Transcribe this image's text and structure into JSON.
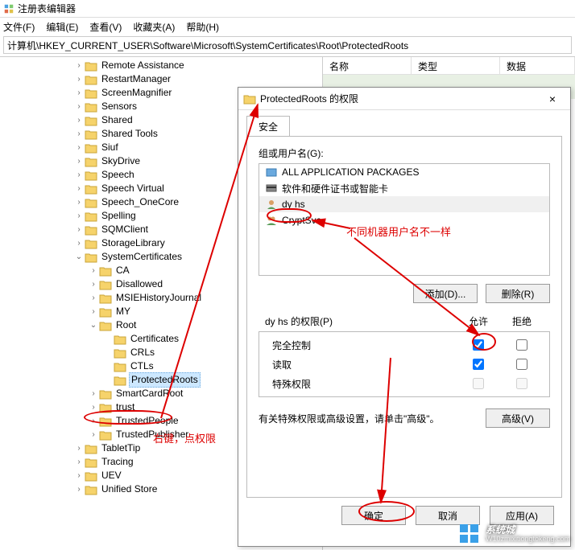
{
  "window": {
    "title": "注册表编辑器"
  },
  "menu": {
    "file": "文件(F)",
    "edit": "编辑(E)",
    "view": "查看(V)",
    "favorites": "收藏夹(A)",
    "help": "帮助(H)"
  },
  "address": {
    "path": "计算机\\HKEY_CURRENT_USER\\Software\\Microsoft\\SystemCertificates\\Root\\ProtectedRoots"
  },
  "listcols": {
    "name": "名称",
    "type": "类型",
    "data": "数据"
  },
  "tree": {
    "items": [
      "Remote Assistance",
      "RestartManager",
      "ScreenMagnifier",
      "Sensors",
      "Shared",
      "Shared Tools",
      "Siuf",
      "SkyDrive",
      "Speech",
      "Speech Virtual",
      "Speech_OneCore",
      "Spelling",
      "SQMClient",
      "StorageLibrary"
    ],
    "syscert": "SystemCertificates",
    "syscert_children": [
      "CA",
      "Disallowed",
      "MSIEHistoryJournal",
      "MY"
    ],
    "root": "Root",
    "root_children": [
      "Certificates",
      "CRLs",
      "CTLs",
      "ProtectedRoots"
    ],
    "after_root": [
      "SmartCardRoot",
      "trust",
      "TrustedPeople",
      "TrustedPublisher"
    ],
    "after_syscert": [
      "TabletTip",
      "Tracing",
      "UEV"
    ],
    "last": "Unified Store"
  },
  "dialog": {
    "title": "ProtectedRoots 的权限",
    "close": "×",
    "tab_security": "安全",
    "group_label": "组或用户名(G):",
    "groups": {
      "g0": "ALL APPLICATION PACKAGES",
      "g1": "软件和硬件证书或智能卡",
      "g2": "dy hs",
      "g3": "CryptSvc"
    },
    "btn_add": "添加(D)...",
    "btn_remove": "删除(R)",
    "perm_label": "dy hs 的权限(P)",
    "col_allow": "允许",
    "col_deny": "拒绝",
    "perm_full": "完全控制",
    "perm_read": "读取",
    "perm_special": "特殊权限",
    "adv_text": "有关特殊权限或高级设置，请单击\"高级\"。",
    "btn_adv": "高级(V)",
    "btn_ok": "确定",
    "btn_cancel": "取消",
    "btn_apply": "应用(A)"
  },
  "annotations": {
    "a1": "右键，点权限",
    "a2": "不同机器用户名不一样"
  },
  "watermark": {
    "text": "系统城",
    "sub": "W10zmixitiongtokeng.com"
  }
}
